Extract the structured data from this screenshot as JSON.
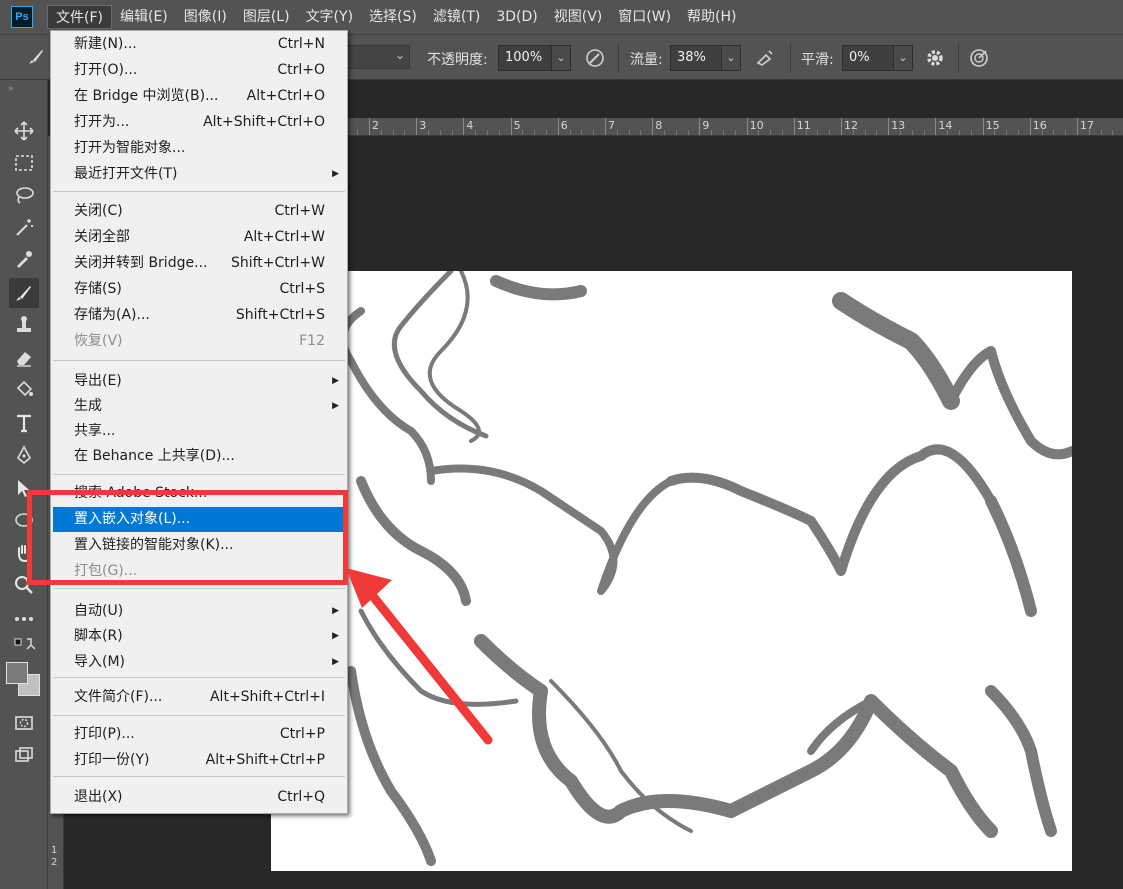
{
  "app": {
    "logo": "Ps"
  },
  "menubar": {
    "items": [
      "文件(F)",
      "编辑(E)",
      "图像(I)",
      "图层(L)",
      "文字(Y)",
      "选择(S)",
      "滤镜(T)",
      "3D(D)",
      "视图(V)",
      "窗口(W)",
      "帮助(H)"
    ],
    "active_index": 0
  },
  "options_bar": {
    "opacity_label": "不透明度:",
    "opacity_value": "100%",
    "flow_label": "流量:",
    "flow_value": "38%",
    "smoothing_label": "平滑:",
    "smoothing_value": "0%"
  },
  "ruler": {
    "h_labels": [
      "2",
      "3",
      "4",
      "5",
      "6",
      "7",
      "8",
      "9",
      "10",
      "11",
      "12",
      "13",
      "14",
      "15",
      "16",
      "17"
    ],
    "v_labels": [
      "1",
      "2"
    ]
  },
  "file_menu": {
    "items": [
      {
        "label": "新建(N)...",
        "shortcut": "Ctrl+N"
      },
      {
        "label": "打开(O)...",
        "shortcut": "Ctrl+O"
      },
      {
        "label": "在 Bridge 中浏览(B)...",
        "shortcut": "Alt+Ctrl+O"
      },
      {
        "label": "打开为...",
        "shortcut": "Alt+Shift+Ctrl+O"
      },
      {
        "label": "打开为智能对象...",
        "shortcut": ""
      },
      {
        "label": "最近打开文件(T)",
        "shortcut": "",
        "submenu": true
      },
      {
        "label": "关闭(C)",
        "shortcut": "Ctrl+W"
      },
      {
        "label": "关闭全部",
        "shortcut": "Alt+Ctrl+W"
      },
      {
        "label": "关闭并转到 Bridge...",
        "shortcut": "Shift+Ctrl+W"
      },
      {
        "label": "存储(S)",
        "shortcut": "Ctrl+S"
      },
      {
        "label": "存储为(A)...",
        "shortcut": "Shift+Ctrl+S"
      },
      {
        "label": "恢复(V)",
        "shortcut": "F12",
        "disabled": true
      },
      {
        "label": "导出(E)",
        "shortcut": "",
        "submenu": true
      },
      {
        "label": "生成",
        "shortcut": "",
        "submenu": true
      },
      {
        "label": "共享...",
        "shortcut": ""
      },
      {
        "label": "在 Behance 上共享(D)...",
        "shortcut": ""
      },
      {
        "label": "搜索 Adobe Stock...",
        "shortcut": ""
      },
      {
        "label": "置入嵌入对象(L)...",
        "shortcut": "",
        "highlighted": true
      },
      {
        "label": "置入链接的智能对象(K)...",
        "shortcut": ""
      },
      {
        "label": "打包(G)...",
        "shortcut": "",
        "disabled": true
      },
      {
        "label": "自动(U)",
        "shortcut": "",
        "submenu": true
      },
      {
        "label": "脚本(R)",
        "shortcut": "",
        "submenu": true
      },
      {
        "label": "导入(M)",
        "shortcut": "",
        "submenu": true
      },
      {
        "label": "文件简介(F)...",
        "shortcut": "Alt+Shift+Ctrl+I"
      },
      {
        "label": "打印(P)...",
        "shortcut": "Ctrl+P"
      },
      {
        "label": "打印一份(Y)",
        "shortcut": "Alt+Shift+Ctrl+P"
      },
      {
        "label": "退出(X)",
        "shortcut": "Ctrl+Q"
      }
    ]
  },
  "colors": {
    "highlight": "#0078d7",
    "annotation": "#f03a3a",
    "ps_logo": "#31a8ff"
  }
}
